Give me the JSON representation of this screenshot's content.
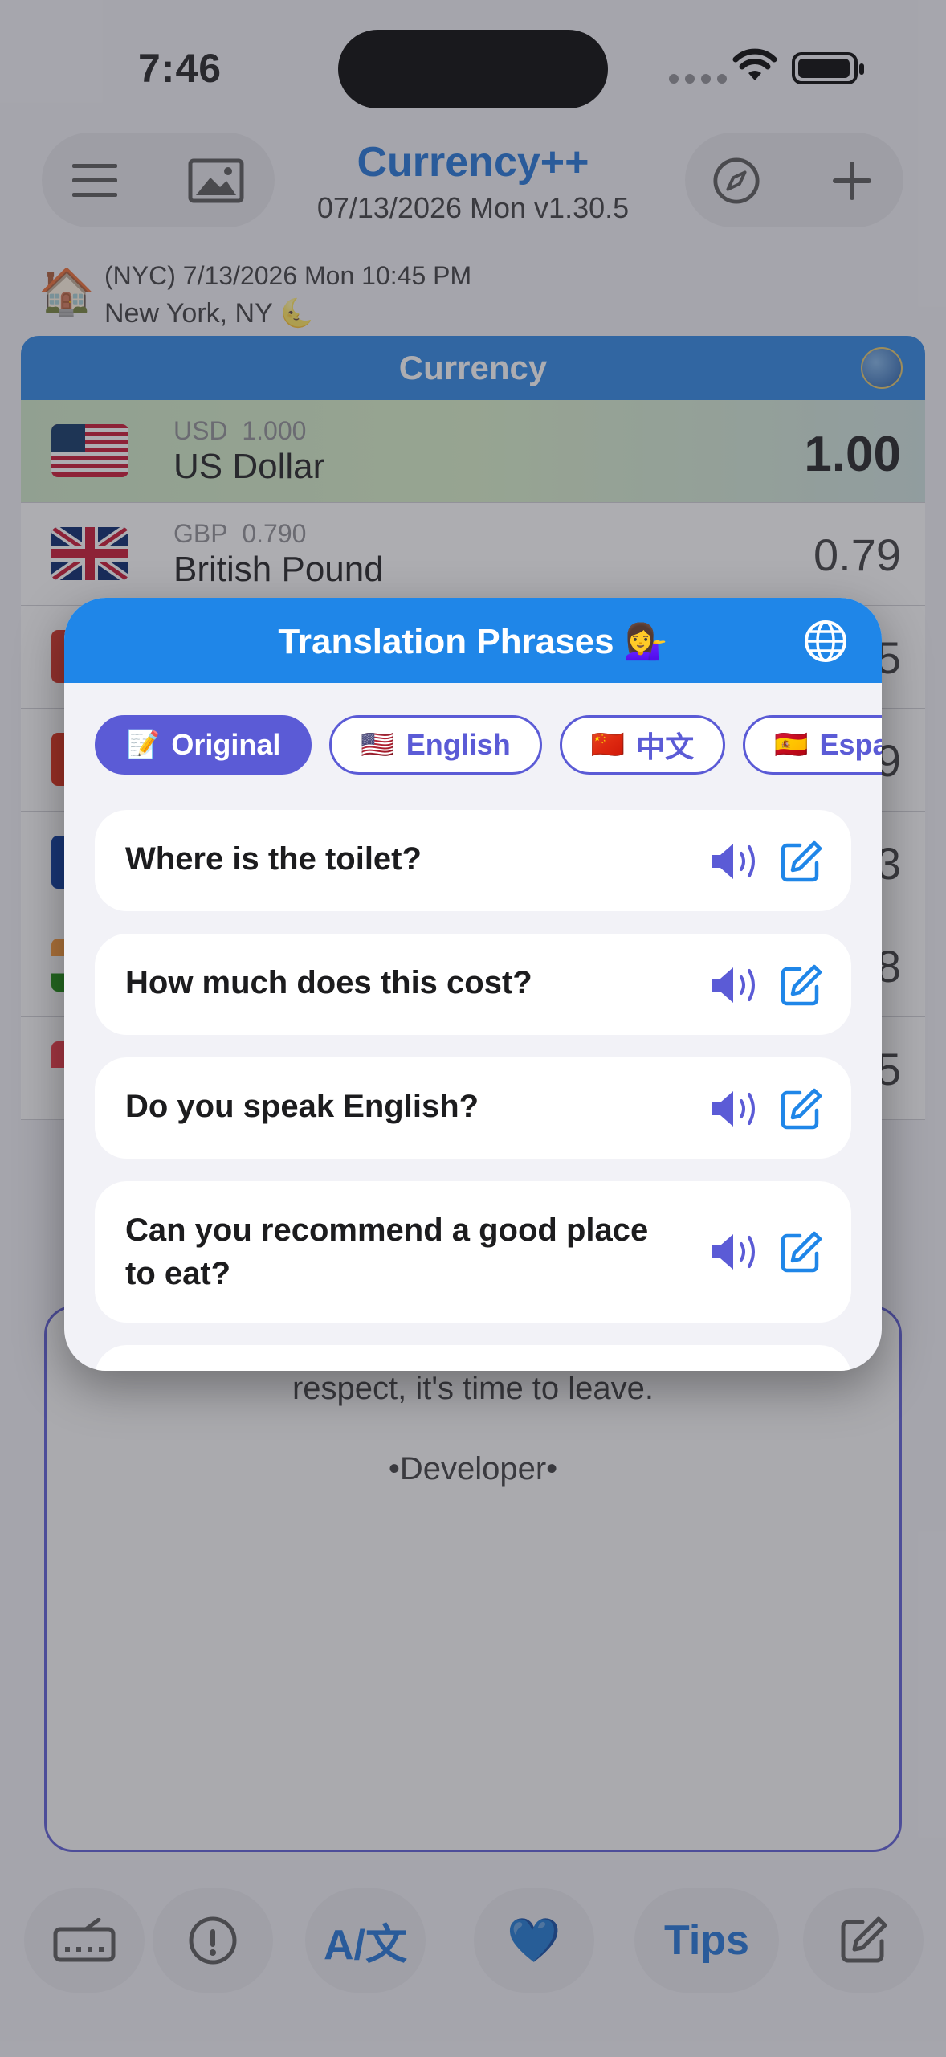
{
  "status_bar": {
    "time": "7:46"
  },
  "header": {
    "title": "Currency++",
    "subtitle": "07/13/2026 Mon v1.30.5"
  },
  "location": {
    "line1": "(NYC) 7/13/2026 Mon 10:45 PM",
    "line2": "New York, NY 🌜"
  },
  "currency_section": {
    "title": "Currency",
    "rows": [
      {
        "code": "USD",
        "rate": "1.000",
        "name": "US Dollar",
        "value": "1.00"
      },
      {
        "code": "GBP",
        "rate": "0.790",
        "name": "British Pound",
        "value": "0.79"
      },
      {
        "value": "5"
      },
      {
        "value": "9"
      },
      {
        "value": "3"
      },
      {
        "value": "8"
      },
      {
        "value": "5"
      }
    ]
  },
  "quote": {
    "text": "respect, it's time to leave.",
    "author": "•Developer•"
  },
  "bottom_bar": {
    "translate_label": "A/文",
    "favorite_emoji": "💙",
    "tips_label": "Tips"
  },
  "modal": {
    "title": "Translation Phrases 💁‍♀️",
    "languages": [
      {
        "emoji": "📝",
        "label": "Original",
        "active": true
      },
      {
        "emoji": "🇺🇸",
        "label": "English",
        "active": false
      },
      {
        "emoji": "🇨🇳",
        "label": "中文",
        "active": false
      },
      {
        "emoji": "🇪🇸",
        "label": "Espa",
        "active": false
      }
    ],
    "phrases": [
      {
        "text": "Where is the toilet?"
      },
      {
        "text": "How much does this cost?"
      },
      {
        "text": "Do you speak English?"
      },
      {
        "text": "Can you recommend a good place to eat?"
      }
    ]
  },
  "colors": {
    "accent": "#1e73d8",
    "modal_header": "#1f86e8",
    "chip_purple": "#5b5bd6"
  },
  "icons": [
    "menu-icon",
    "image-icon",
    "compass-icon",
    "plus-icon",
    "globe-icon",
    "speaker-icon",
    "edit-icon",
    "keyboard-icon",
    "info-icon"
  ]
}
